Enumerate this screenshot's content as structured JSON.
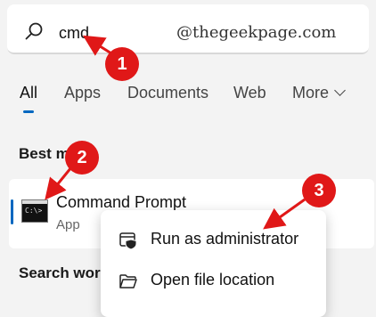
{
  "search": {
    "query": "cmd"
  },
  "watermark": "@thegeekpage.com",
  "tabs": [
    {
      "label": "All",
      "active": true
    },
    {
      "label": "Apps"
    },
    {
      "label": "Documents"
    },
    {
      "label": "Web"
    },
    {
      "label": "More"
    }
  ],
  "best_match": {
    "title": "Best m",
    "result": {
      "title": "Command Prompt",
      "subtitle": "App",
      "icon_text": "C:\\>"
    }
  },
  "context_menu": {
    "items": [
      {
        "label": "Run as administrator",
        "icon": "shield-window-icon"
      },
      {
        "label": "Open file location",
        "icon": "folder-icon"
      }
    ]
  },
  "search_work": {
    "title": "Search worl"
  },
  "annotations": {
    "badges": [
      "1",
      "2",
      "3"
    ],
    "color": "#e01818"
  },
  "colors": {
    "accent": "#0067c0",
    "background": "#f3f3f3"
  }
}
